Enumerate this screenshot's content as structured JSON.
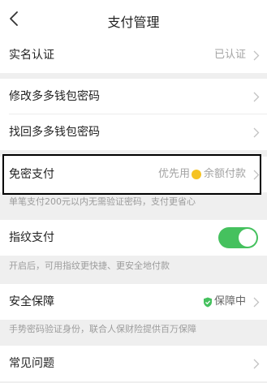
{
  "header": {
    "title": "支付管理"
  },
  "rows": {
    "realname": {
      "label": "实名认证",
      "status": "已认证"
    },
    "modify_pwd": {
      "label": "修改多多钱包密码"
    },
    "recover_pwd": {
      "label": "找回多多钱包密码"
    },
    "nopwd_pay": {
      "label": "免密支付",
      "value_prefix": "优先用",
      "value_suffix": "余额付款",
      "note": "单笔支付200元以内无需验证密码，支付更省心"
    },
    "fingerprint": {
      "label": "指纹支付",
      "enabled": true,
      "note": "开启后，可用指纹更快捷、更安全地付款"
    },
    "security": {
      "label": "安全保障",
      "status": "保障中",
      "note": "手势密码验证身份，联合人保财险提供百万保障"
    },
    "faq": {
      "label": "常见问题"
    }
  },
  "colors": {
    "accent_green": "#45c15e",
    "coin_yellow": "#f5c324",
    "background": "#efefef"
  },
  "icons": [
    "back-arrow-icon",
    "chevron-right-icon",
    "coin-icon",
    "shield-check-icon"
  ]
}
